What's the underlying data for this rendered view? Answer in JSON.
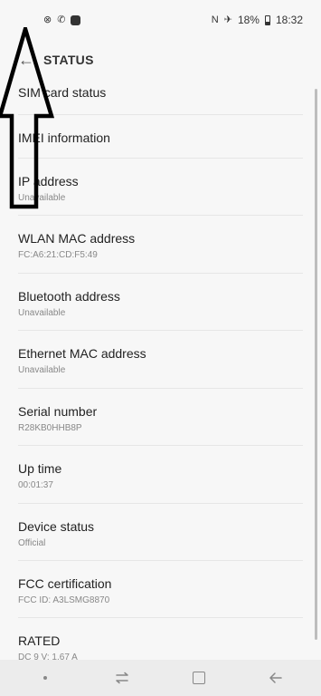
{
  "status_bar": {
    "battery": "18%",
    "time": "18:32",
    "icons": [
      "blocked-icon",
      "call-forwarding-icon",
      "message-icon",
      "nfc-icon",
      "airplane-mode-icon",
      "battery-icon"
    ]
  },
  "header": {
    "title": "STATUS",
    "back_icon": "back-arrow-icon"
  },
  "items": [
    {
      "title": "SIM card status",
      "subtitle": ""
    },
    {
      "title": "IMEI information",
      "subtitle": ""
    },
    {
      "title": "IP address",
      "subtitle": "Unavailable"
    },
    {
      "title": "WLAN MAC address",
      "subtitle": "FC:A6:21:CD:F5:49"
    },
    {
      "title": "Bluetooth address",
      "subtitle": "Unavailable"
    },
    {
      "title": "Ethernet MAC address",
      "subtitle": "Unavailable"
    },
    {
      "title": "Serial number",
      "subtitle": "R28KB0HHB8P"
    },
    {
      "title": "Up time",
      "subtitle": "00:01:37"
    },
    {
      "title": "Device status",
      "subtitle": "Official"
    },
    {
      "title": "FCC certification",
      "subtitle": "FCC ID: A3LSMG8870"
    },
    {
      "title": "RATED",
      "subtitle": "DC 9 V; 1.67 A"
    }
  ],
  "nav_bar": {
    "icons": [
      "dot-icon",
      "recents-icon",
      "home-icon",
      "back-icon"
    ]
  }
}
